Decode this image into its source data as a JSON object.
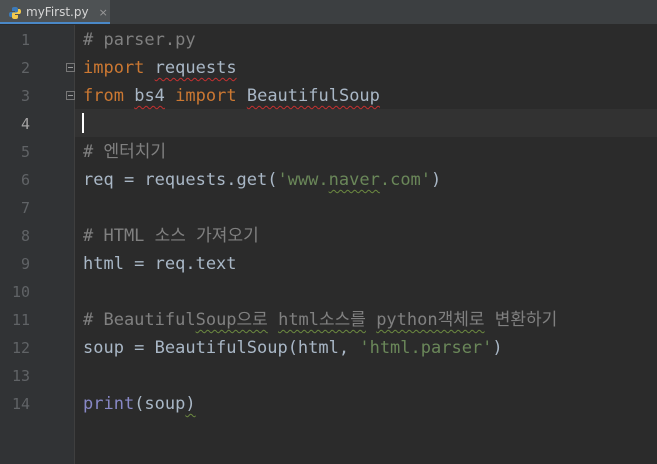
{
  "tab": {
    "label": "myFirst.py",
    "close": "×"
  },
  "line_numbers": [
    "1",
    "2",
    "3",
    "4",
    "5",
    "6",
    "7",
    "8",
    "9",
    "10",
    "11",
    "12",
    "13",
    "14"
  ],
  "code": {
    "l1": "# parser.py",
    "l2_kw": "import",
    "l2_mod": "requests",
    "l3_kw1": "from",
    "l3_mod": "bs4",
    "l3_kw2": "import",
    "l3_name": "BeautifulSoup",
    "l5": "# 엔터치기",
    "l6_a": "req = requests.get(",
    "l6_s1": "'www.",
    "l6_s2": "naver",
    "l6_s3": ".com'",
    "l6_b": ")",
    "l8": "# HTML 소스 가져오기",
    "l9": "html = req.text",
    "l11_a": "# Beautiful",
    "l11_b": "Soup으로",
    "l11_c": " ",
    "l11_d": "html소스를",
    "l11_e": " ",
    "l11_f": "python객체로",
    "l11_g": " 변환하기",
    "l12_a": "soup = BeautifulSoup(html, ",
    "l12_s": "'html.parser'",
    "l12_b": ")",
    "l14_fn": "print",
    "l14_a": "(soup",
    "l14_b": ")"
  }
}
